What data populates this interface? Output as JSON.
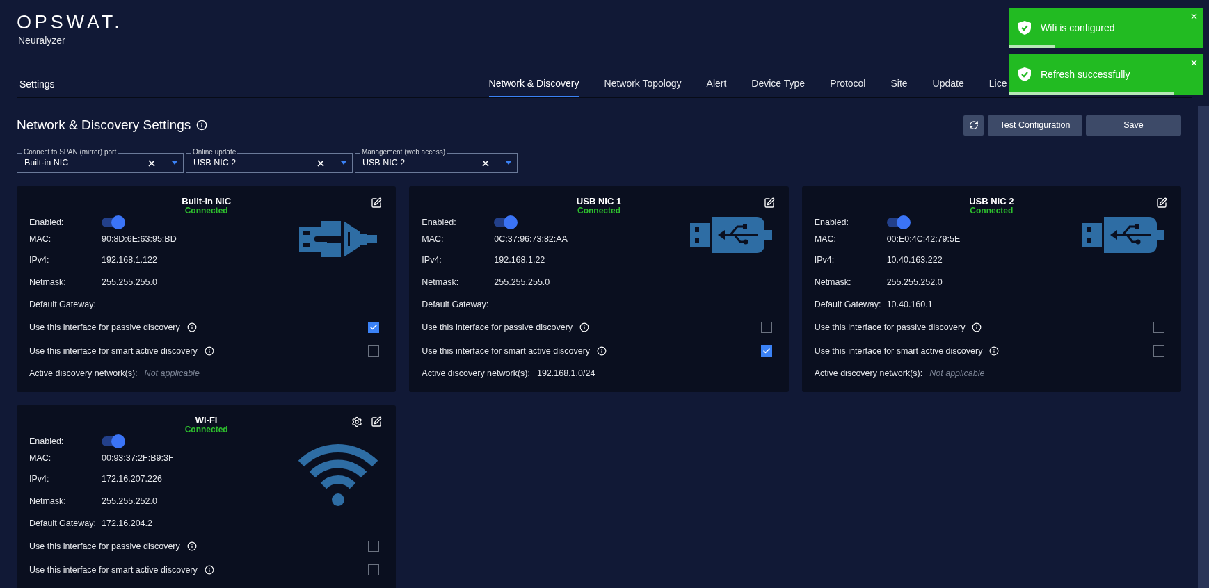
{
  "logo": "OPSWAT.",
  "product": "Neuralyzer",
  "header": {
    "title": "Settings",
    "tabs": [
      {
        "label": "Network & Discovery",
        "selected": true
      },
      {
        "label": "Network Topology",
        "selected": false
      },
      {
        "label": "Alert",
        "selected": false
      },
      {
        "label": "Device Type",
        "selected": false
      },
      {
        "label": "Protocol",
        "selected": false
      },
      {
        "label": "Site",
        "selected": false
      },
      {
        "label": "Update",
        "selected": false
      },
      {
        "label": "Lice",
        "selected": false
      }
    ]
  },
  "toasts": [
    {
      "message": "Wifi is configured",
      "level": 0.24
    },
    {
      "message": "Refresh successfully",
      "level": 0.85
    }
  ],
  "page": {
    "title": "Network & Discovery Settings",
    "buttons": [
      "Test Configuration",
      "Save"
    ]
  },
  "selects": [
    {
      "label": "Connect to SPAN (mirror) port",
      "value": "Built-in NIC"
    },
    {
      "label": "Online update",
      "value": "USB NIC 2"
    },
    {
      "label": "Management (web access)",
      "value": "USB NIC 2"
    }
  ],
  "cards": [
    {
      "title": "Built-in NIC",
      "status": "Connected",
      "kind": "ethernet",
      "settings": false,
      "enabled_label": "Enabled:",
      "enabled": true,
      "fields": [
        {
          "label": "MAC:",
          "value": "90:8D:6E:63:95:BD"
        },
        {
          "label": "IPv4:",
          "value": "192.168.1.122"
        },
        {
          "label": "Netmask:",
          "value": "255.255.255.0"
        },
        {
          "label": "Default Gateway:"
        }
      ],
      "options": [
        {
          "label": "Use this interface for passive discovery",
          "checked": true
        },
        {
          "label": "Use this interface for smart active discovery",
          "checked": false
        }
      ],
      "networks": {
        "label": "Active discovery network(s):",
        "value": "Not applicable",
        "muted": true
      }
    },
    {
      "title": "USB NIC 1",
      "status": "Connected",
      "kind": "usb",
      "settings": false,
      "enabled_label": "Enabled:",
      "enabled": true,
      "fields": [
        {
          "label": "MAC:",
          "value": "0C:37:96:73:82:AA"
        },
        {
          "label": "IPv4:",
          "value": "192.168.1.22"
        },
        {
          "label": "Netmask:",
          "value": "255.255.255.0"
        },
        {
          "label": "Default Gateway:"
        }
      ],
      "options": [
        {
          "label": "Use this interface for passive discovery",
          "checked": false
        },
        {
          "label": "Use this interface for smart active discovery",
          "checked": true
        }
      ],
      "networks": {
        "label": "Active discovery network(s):",
        "value": "192.168.1.0/24",
        "muted": false
      }
    },
    {
      "title": "USB NIC 2",
      "status": "Connected",
      "kind": "usb",
      "settings": false,
      "enabled_label": "Enabled:",
      "enabled": true,
      "fields": [
        {
          "label": "MAC:",
          "value": "00:E0:4C:42:79:5E"
        },
        {
          "label": "IPv4:",
          "value": "10.40.163.222"
        },
        {
          "label": "Netmask:",
          "value": "255.255.252.0"
        },
        {
          "label": "Default Gateway:",
          "value": "10.40.160.1"
        }
      ],
      "options": [
        {
          "label": "Use this interface for passive discovery",
          "checked": false
        },
        {
          "label": "Use this interface for smart active discovery",
          "checked": false
        }
      ],
      "networks": {
        "label": "Active discovery network(s):",
        "value": "Not applicable",
        "muted": true
      }
    },
    {
      "title": "Wi-Fi",
      "status": "Connected",
      "kind": "wifi",
      "settings": true,
      "enabled_label": "Enabled:",
      "enabled": true,
      "fields": [
        {
          "label": "MAC:",
          "value": "00:93:37:2F:B9:3F"
        },
        {
          "label": "IPv4:",
          "value": "172.16.207.226"
        },
        {
          "label": "Netmask:",
          "value": "255.255.252.0"
        },
        {
          "label": "Default Gateway:",
          "value": "172.16.204.2"
        }
      ],
      "options": [
        {
          "label": "Use this interface for passive discovery",
          "checked": false
        },
        {
          "label": "Use this interface for smart active discovery",
          "checked": false
        }
      ]
    }
  ]
}
